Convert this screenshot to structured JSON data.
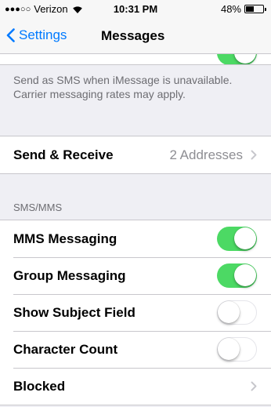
{
  "status_bar": {
    "signal_dots": "●●●○○",
    "carrier": "Verizon",
    "time": "10:31 PM",
    "battery_percent": "48%",
    "battery_level": 0.48
  },
  "nav": {
    "back_label": "Settings",
    "title": "Messages"
  },
  "imessage_footer": "Send as SMS when iMessage is unavailable. Carrier messaging rates may apply.",
  "send_receive": {
    "label": "Send & Receive",
    "detail": "2 Addresses"
  },
  "sms_mms": {
    "header": "SMS/MMS",
    "rows": [
      {
        "label": "MMS Messaging",
        "on": true
      },
      {
        "label": "Group Messaging",
        "on": true
      },
      {
        "label": "Show Subject Field",
        "on": false
      },
      {
        "label": "Character Count",
        "on": false
      },
      {
        "label": "Blocked"
      }
    ]
  },
  "colors": {
    "accent": "#007aff",
    "toggle_on": "#4cd964",
    "background": "#efeff4"
  }
}
